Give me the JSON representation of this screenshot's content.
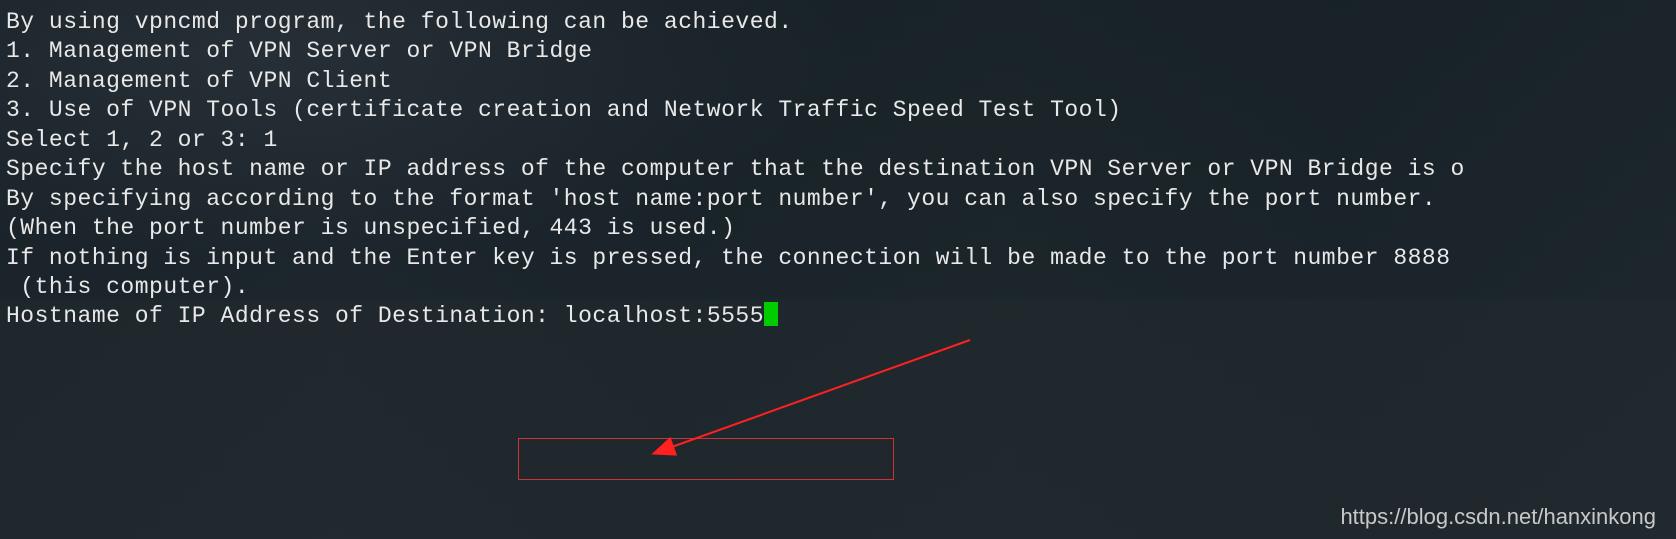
{
  "terminal": {
    "intro": "By using vpncmd program, the following can be achieved.",
    "blank1": "",
    "option1": "1. Management of VPN Server or VPN Bridge",
    "option2": "2. Management of VPN Client",
    "option3": "3. Use of VPN Tools (certificate creation and Network Traffic Speed Test Tool)",
    "blank2": "",
    "select_prompt": "Select 1, 2 or 3: ",
    "select_input": "1",
    "blank3": "",
    "specify_line": "Specify the host name or IP address of the computer that the destination VPN Server or VPN Bridge is o",
    "blank4": "",
    "format_line": "By specifying according to the format 'host name:port number', you can also specify the port number.",
    "port_line": "(When the port number is unspecified, 443 is used.)",
    "enter_line": "If nothing is input and the Enter key is pressed, the connection will be made to the port number 8888",
    "this_computer": " (this computer).",
    "hostname_prompt": "Hostname of IP Address of Destination: ",
    "hostname_input": "localhost:5555"
  },
  "watermark": "https://blog.csdn.net/hanxinkong"
}
